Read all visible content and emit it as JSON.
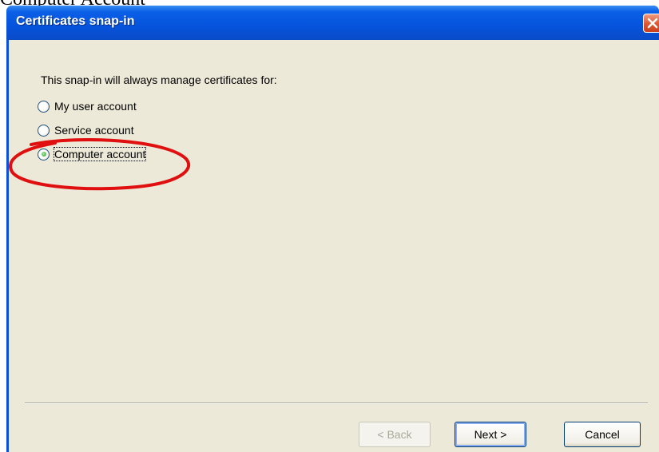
{
  "document": {
    "caption_fragment": "Computer Account"
  },
  "window": {
    "title": "Certificates snap-in",
    "close_icon": "close-icon",
    "accent_color": "#0a50d8",
    "close_color": "#e0552f"
  },
  "content": {
    "intro": "This snap-in will always manage certificates for:",
    "options": [
      {
        "label": "My user account",
        "checked": false
      },
      {
        "label": "Service account",
        "checked": false
      },
      {
        "label": "Computer account",
        "checked": true
      }
    ],
    "annotation": {
      "shape": "ellipse",
      "color": "#e01010",
      "target": "Computer account"
    }
  },
  "buttons": {
    "back": {
      "label": "< Back",
      "enabled": false
    },
    "next": {
      "label": "Next >",
      "enabled": true,
      "default": true
    },
    "cancel": {
      "label": "Cancel",
      "enabled": true
    }
  }
}
